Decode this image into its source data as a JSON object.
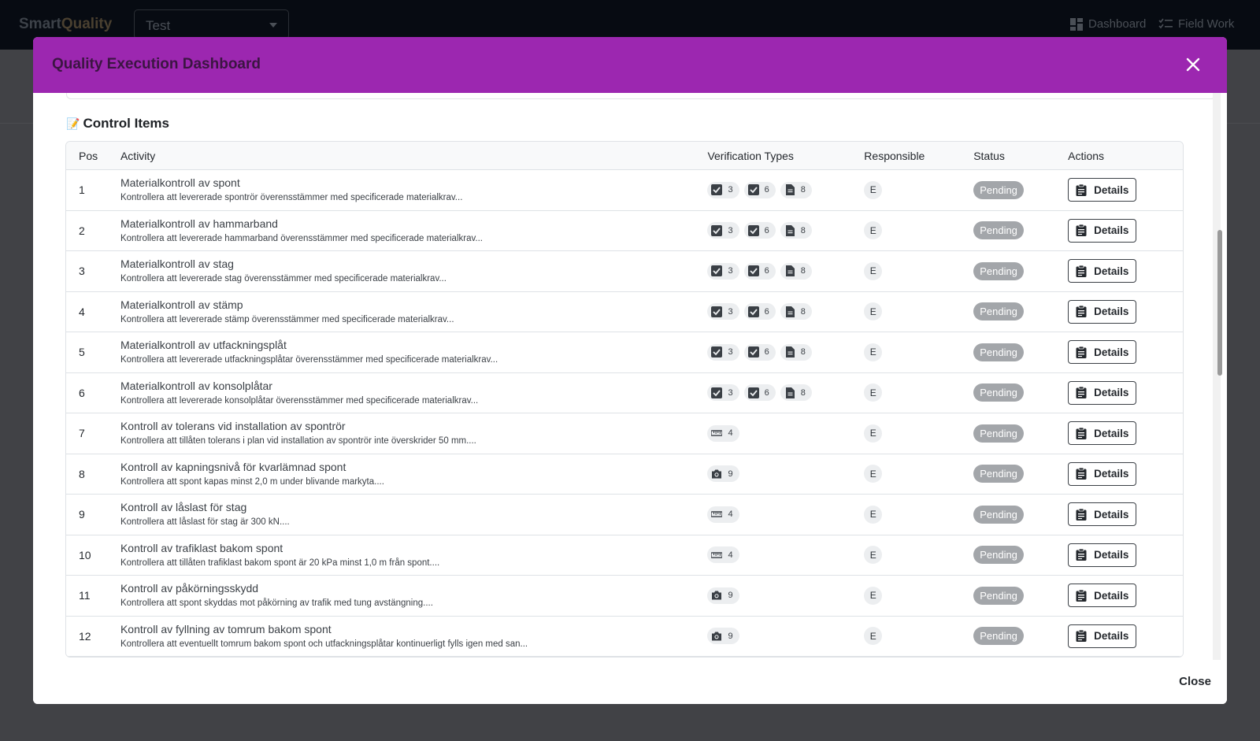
{
  "app": {
    "brand_smart": "Smart",
    "brand_quality": "Quality",
    "project_selected": "Test",
    "nav": {
      "dashboard": "Dashboard",
      "field_work": "Field Work"
    }
  },
  "modal": {
    "title": "Quality Execution Dashboard",
    "section_title": "Control Items",
    "close_label": "Close"
  },
  "table": {
    "headers": {
      "pos": "Pos",
      "activity": "Activity",
      "verification": "Verification Types",
      "responsible": "Responsible",
      "status": "Status",
      "actions": "Actions"
    },
    "details_label": "Details",
    "rows": [
      {
        "pos": "1",
        "title": "Materialkontroll av spont",
        "desc": "Kontrollera att levererade spontrör överensstämmer med specificerade materialkrav...",
        "verif": [
          {
            "icon": "checkbox-icon",
            "count": "3"
          },
          {
            "icon": "checkbox-icon",
            "count": "6"
          },
          {
            "icon": "document-icon",
            "count": "8"
          }
        ],
        "resp": "E",
        "status": "Pending"
      },
      {
        "pos": "2",
        "title": "Materialkontroll av hammarband",
        "desc": "Kontrollera att levererade hammarband överensstämmer med specificerade materialkrav...",
        "verif": [
          {
            "icon": "checkbox-icon",
            "count": "3"
          },
          {
            "icon": "checkbox-icon",
            "count": "6"
          },
          {
            "icon": "document-icon",
            "count": "8"
          }
        ],
        "resp": "E",
        "status": "Pending"
      },
      {
        "pos": "3",
        "title": "Materialkontroll av stag",
        "desc": "Kontrollera att levererade stag överensstämmer med specificerade materialkrav...",
        "verif": [
          {
            "icon": "checkbox-icon",
            "count": "3"
          },
          {
            "icon": "checkbox-icon",
            "count": "6"
          },
          {
            "icon": "document-icon",
            "count": "8"
          }
        ],
        "resp": "E",
        "status": "Pending"
      },
      {
        "pos": "4",
        "title": "Materialkontroll av stämp",
        "desc": "Kontrollera att levererade stämp överensstämmer med specificerade materialkrav...",
        "verif": [
          {
            "icon": "checkbox-icon",
            "count": "3"
          },
          {
            "icon": "checkbox-icon",
            "count": "6"
          },
          {
            "icon": "document-icon",
            "count": "8"
          }
        ],
        "resp": "E",
        "status": "Pending"
      },
      {
        "pos": "5",
        "title": "Materialkontroll av utfackningsplåt",
        "desc": "Kontrollera att levererade utfackningsplåtar överensstämmer med specificerade materialkrav...",
        "verif": [
          {
            "icon": "checkbox-icon",
            "count": "3"
          },
          {
            "icon": "checkbox-icon",
            "count": "6"
          },
          {
            "icon": "document-icon",
            "count": "8"
          }
        ],
        "resp": "E",
        "status": "Pending"
      },
      {
        "pos": "6",
        "title": "Materialkontroll av konsolplåtar",
        "desc": "Kontrollera att levererade konsolplåtar överensstämmer med specificerade materialkrav...",
        "verif": [
          {
            "icon": "checkbox-icon",
            "count": "3"
          },
          {
            "icon": "checkbox-icon",
            "count": "6"
          },
          {
            "icon": "document-icon",
            "count": "8"
          }
        ],
        "resp": "E",
        "status": "Pending"
      },
      {
        "pos": "7",
        "title": "Kontroll av tolerans vid installation av spontrör",
        "desc": "Kontrollera att tillåten tolerans i plan vid installation av spontrör inte överskrider 50 mm....",
        "verif": [
          {
            "icon": "ruler-icon",
            "count": "4"
          }
        ],
        "resp": "E",
        "status": "Pending"
      },
      {
        "pos": "8",
        "title": "Kontroll av kapningsnivå för kvarlämnad spont",
        "desc": "Kontrollera att spont kapas minst 2,0 m under blivande markyta....",
        "verif": [
          {
            "icon": "camera-icon",
            "count": "9"
          }
        ],
        "resp": "E",
        "status": "Pending"
      },
      {
        "pos": "9",
        "title": "Kontroll av låslast för stag",
        "desc": "Kontrollera att låslast för stag är 300 kN....",
        "verif": [
          {
            "icon": "ruler-icon",
            "count": "4"
          }
        ],
        "resp": "E",
        "status": "Pending"
      },
      {
        "pos": "10",
        "title": "Kontroll av trafiklast bakom spont",
        "desc": "Kontrollera att tillåten trafiklast bakom spont är 20 kPa minst 1,0 m från spont....",
        "verif": [
          {
            "icon": "ruler-icon",
            "count": "4"
          }
        ],
        "resp": "E",
        "status": "Pending"
      },
      {
        "pos": "11",
        "title": "Kontroll av påkörningsskydd",
        "desc": "Kontrollera att spont skyddas mot påkörning av trafik med tung avstängning....",
        "verif": [
          {
            "icon": "camera-icon",
            "count": "9"
          }
        ],
        "resp": "E",
        "status": "Pending"
      },
      {
        "pos": "12",
        "title": "Kontroll av fyllning av tomrum bakom spont",
        "desc": "Kontrollera att eventuellt tomrum bakom spont och utfackningsplåtar kontinuerligt fylls igen med san...",
        "verif": [
          {
            "icon": "camera-icon",
            "count": "9"
          }
        ],
        "resp": "E",
        "status": "Pending"
      }
    ]
  },
  "colors": {
    "header_purple": "#9c27b0",
    "status_pending": "#a3a6aa",
    "backdrop": "#3a3b3f"
  }
}
